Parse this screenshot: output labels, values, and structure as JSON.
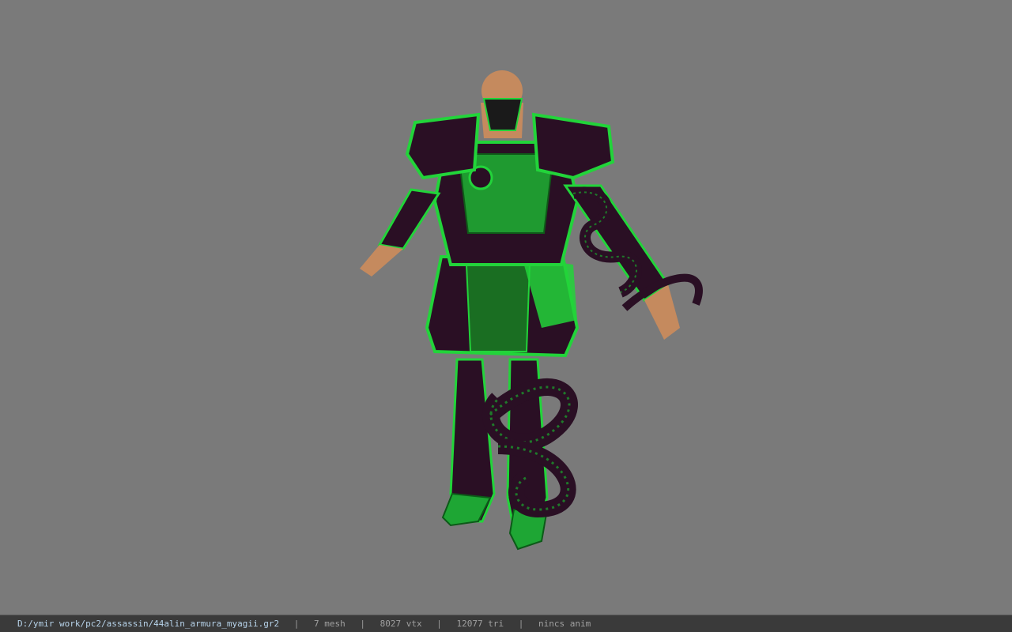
{
  "status": {
    "path": "D:/ymir work/pc2/assassin/44alin_armura_myagii.gr2",
    "separator": "|",
    "mesh": "7 mesh",
    "vtx": "8027 vtx",
    "tri": "12077 tri",
    "anim": "nincs anim"
  },
  "colors": {
    "background": "#7a7a7a",
    "statusbar": "#3a3a3a",
    "armor_green": "#22d43a",
    "armor_dark": "#2a0f24",
    "skin": "#c58a5e"
  }
}
